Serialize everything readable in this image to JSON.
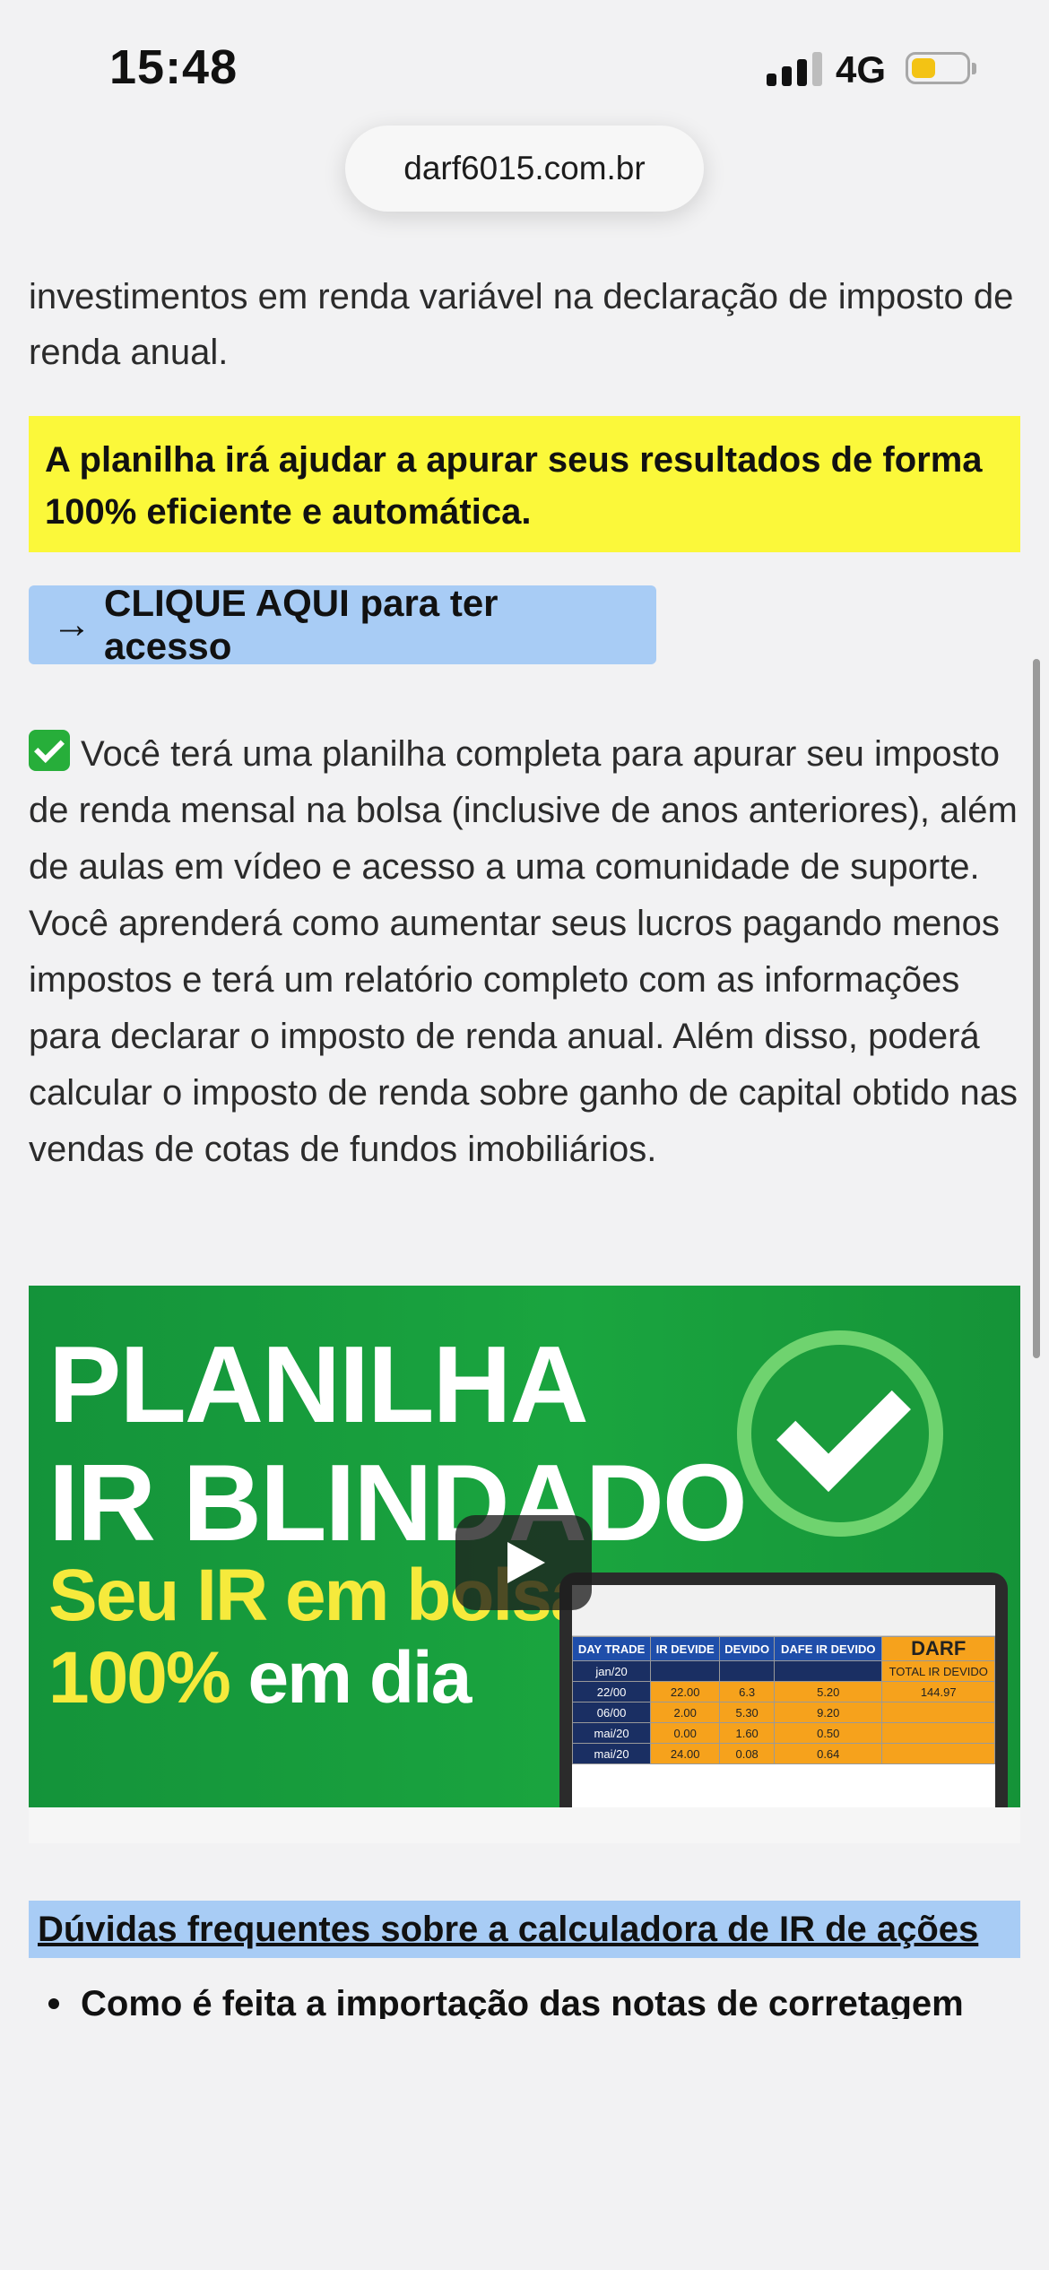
{
  "status_bar": {
    "time": "15:48",
    "network": "4G",
    "battery_level": 0.35
  },
  "browser": {
    "url": "darf6015.com.br"
  },
  "intro": {
    "text": "investimentos em renda variável na declaração de imposto de renda anual."
  },
  "highlight": {
    "text": "A planilha irá ajudar a apurar seus resultados de forma 100% eficiente e automática."
  },
  "cta": {
    "arrow": "→",
    "label": "CLIQUE AQUI para ter acesso"
  },
  "body": {
    "text": "Você terá uma planilha completa para apurar seu imposto de renda mensal na bolsa (inclusive de anos anteriores), além de aulas em vídeo e acesso a uma comunidade de suporte. Você aprenderá como aumentar seus lucros pagando menos impostos e terá um relatório completo com as informações para declarar o imposto de renda anual. Além disso, poderá calcular o imposto de renda sobre ganho de capital obtido nas vendas de cotas de fundos imobiliários."
  },
  "video": {
    "title_line1": "PLANILHA",
    "title_line2": "IR BLINDADO",
    "subtitle_line1": "Seu IR em bolsa",
    "subtitle_line2_yellow": "100%",
    "subtitle_line2_white": "em dia",
    "sheet": {
      "col_day_trade": "DAY TRADE",
      "col_ir_devide": "IR DEVIDE",
      "col_devido": "DEVIDO",
      "col_dafe": "DAFE IR DEVIDO",
      "darf_label": "DARF",
      "total_label": "TOTAL IR DEVIDO",
      "rows": [
        [
          "jan/20",
          "",
          "",
          "",
          ""
        ],
        [
          "22/00",
          "22.00",
          "6.3",
          "5.20",
          "144.97"
        ],
        [
          "06/00",
          "2.00",
          "5.30",
          "9.20",
          ""
        ],
        [
          "mai/20",
          "0.00",
          "1.60",
          "0.50",
          ""
        ],
        [
          "mai/20",
          "24.00",
          "0.08",
          "0.64",
          ""
        ]
      ]
    }
  },
  "faq": {
    "heading": "Dúvidas frequentes sobre a calculadora de IR de ações",
    "items": [
      "Como é feita a importação das notas de corretagem"
    ]
  }
}
